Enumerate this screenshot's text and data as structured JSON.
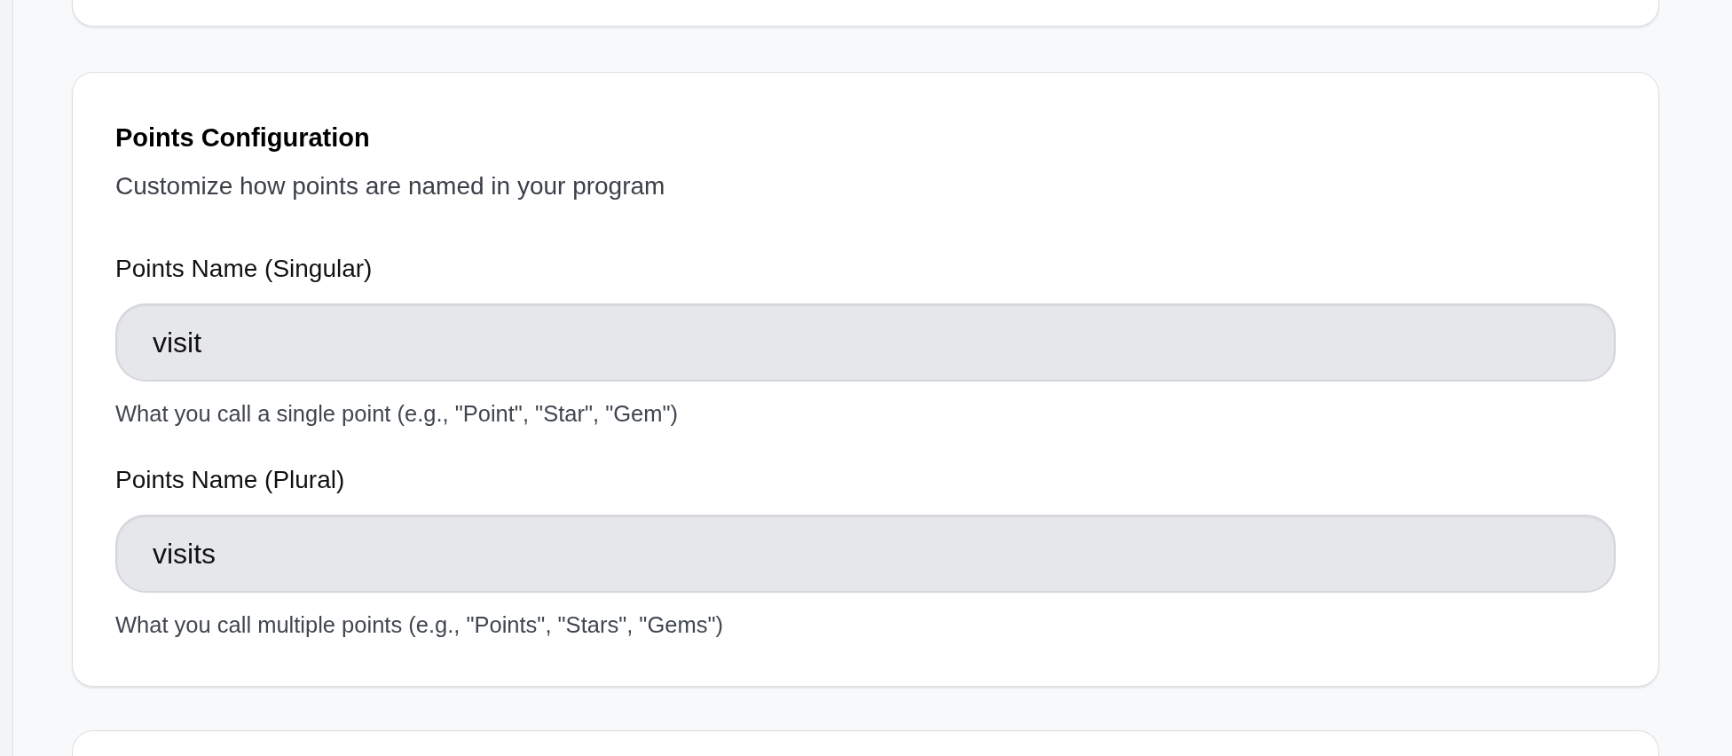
{
  "section": {
    "title": "Points Configuration",
    "description": "Customize how points are named in your program",
    "fields": [
      {
        "label": "Points Name (Singular)",
        "value": "visit",
        "help": "What you call a single point (e.g., \"Point\", \"Star\", \"Gem\")"
      },
      {
        "label": "Points Name (Plural)",
        "value": "visits",
        "help": "What you call multiple points (e.g., \"Points\", \"Stars\", \"Gems\")"
      }
    ]
  }
}
